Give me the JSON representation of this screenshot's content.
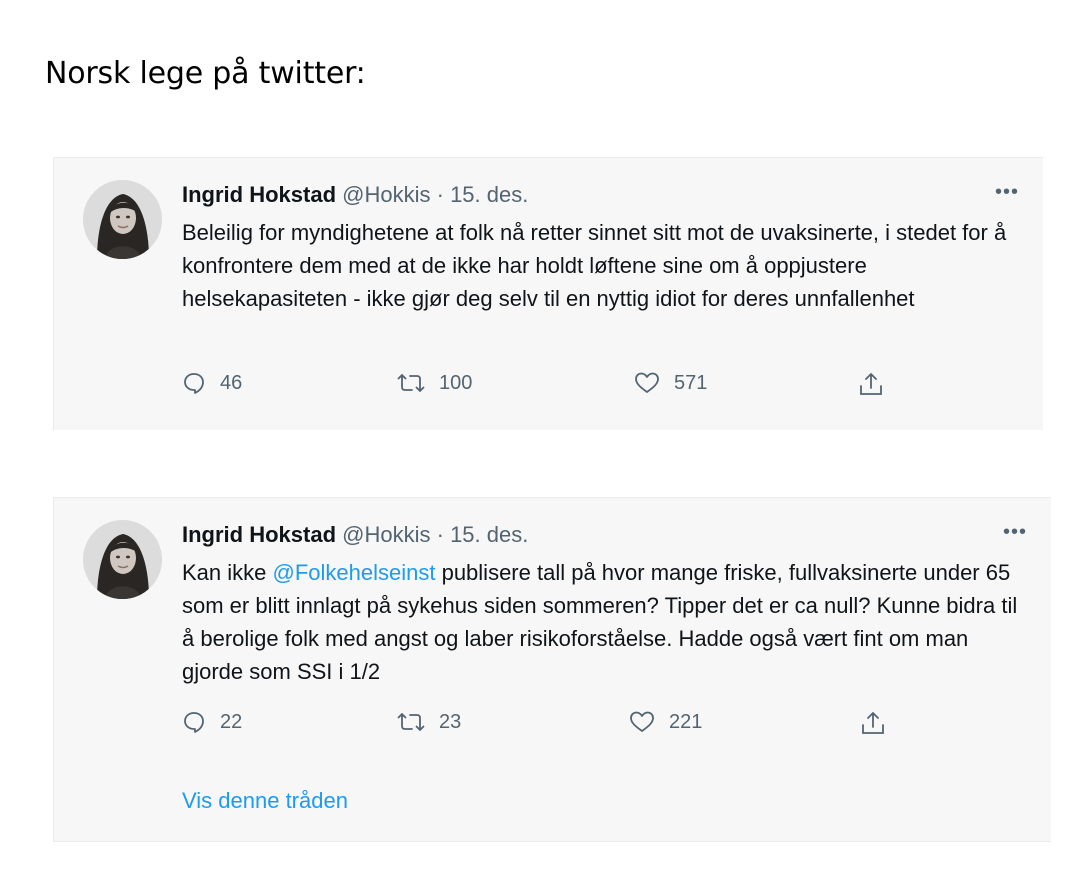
{
  "page": {
    "heading": "Norsk lege på twitter:"
  },
  "tweets": [
    {
      "author": {
        "name": "Ingrid Hokstad",
        "handle": "@Hokkis"
      },
      "date": "15. des.",
      "separator": "·",
      "more": "•••",
      "text_parts": [
        {
          "type": "text",
          "value": "Beleilig for myndighetene at folk nå retter sinnet sitt mot de uvaksinerte, i stedet for å konfrontere dem med at de ikke har holdt løftene sine om å oppjustere helsekapasiteten - ikke gjør deg selv til en nyttig idiot for deres unnfallenhet"
        }
      ],
      "stats": {
        "replies": "46",
        "retweets": "100",
        "likes": "571"
      },
      "icons": [
        "reply-icon",
        "retweet-icon",
        "like-icon",
        "share-icon"
      ]
    },
    {
      "author": {
        "name": "Ingrid Hokstad",
        "handle": "@Hokkis"
      },
      "date": "15. des.",
      "separator": "·",
      "more": "•••",
      "text_parts": [
        {
          "type": "text",
          "value": "Kan ikke "
        },
        {
          "type": "mention",
          "value": "@Folkehelseinst"
        },
        {
          "type": "text",
          "value": " publisere tall på hvor mange friske, fullvaksinerte under 65 som er blitt innlagt på sykehus siden sommeren? Tipper det er ca null? Kunne bidra til å berolige folk med angst og laber risikoforståelse. Hadde også vært fint om man gjorde som SSI i 1/2"
        }
      ],
      "stats": {
        "replies": "22",
        "retweets": "23",
        "likes": "221"
      },
      "show_thread": "Vis denne tråden",
      "icons": [
        "reply-icon",
        "retweet-icon",
        "like-icon",
        "share-icon"
      ]
    }
  ],
  "colors": {
    "link": "#1d9bf0",
    "muted": "#536471",
    "card_bg": "#f7f7f7"
  }
}
